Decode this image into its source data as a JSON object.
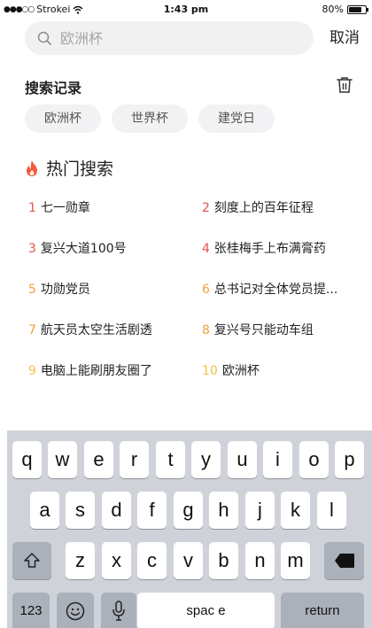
{
  "status": {
    "carrier": "Strokei",
    "time": "1:43 pm",
    "battery": "80%",
    "battery_level": 0.8
  },
  "search": {
    "placeholder": "欧洲杯",
    "value": "",
    "cancel_label": "取消"
  },
  "history": {
    "title": "搜索记录",
    "items": [
      "欧洲杯",
      "世界杯",
      "建党日"
    ]
  },
  "hot": {
    "title": "热门搜索",
    "items": [
      {
        "rank": "1",
        "text": "七一勋章",
        "color": "#e2554b"
      },
      {
        "rank": "2",
        "text": "刻度上的百年征程",
        "color": "#e2554b"
      },
      {
        "rank": "3",
        "text": "复兴大道100号",
        "color": "#e2554b"
      },
      {
        "rank": "4",
        "text": "张桂梅手上布满膏药",
        "color": "#e2554b"
      },
      {
        "rank": "5",
        "text": "功勋党员",
        "color": "#f0a13c"
      },
      {
        "rank": "6",
        "text": "总书记对全体党员提...",
        "color": "#f0a13c"
      },
      {
        "rank": "7",
        "text": "航天员太空生活剧透",
        "color": "#f0a13c"
      },
      {
        "rank": "8",
        "text": "复兴号只能动车组",
        "color": "#f0a13c"
      },
      {
        "rank": "9",
        "text": "电脑上能刷朋友圈了",
        "color": "#f2c04a"
      },
      {
        "rank": "10",
        "text": "欧洲杯",
        "color": "#f2c04a"
      }
    ]
  },
  "keyboard": {
    "row1": [
      "q",
      "w",
      "e",
      "r",
      "t",
      "y",
      "u",
      "i",
      "o",
      "p"
    ],
    "row2": [
      "a",
      "s",
      "d",
      "f",
      "g",
      "h",
      "j",
      "k",
      "l"
    ],
    "row3": [
      "z",
      "x",
      "c",
      "v",
      "b",
      "n",
      "m"
    ],
    "numbers_label": "123",
    "space_label": "spac e",
    "return_label": "return"
  },
  "colors": {
    "accent_fire": "#f05a3a",
    "search_bg": "#f1f1f2",
    "keyboard_bg": "#cfd3d9"
  }
}
